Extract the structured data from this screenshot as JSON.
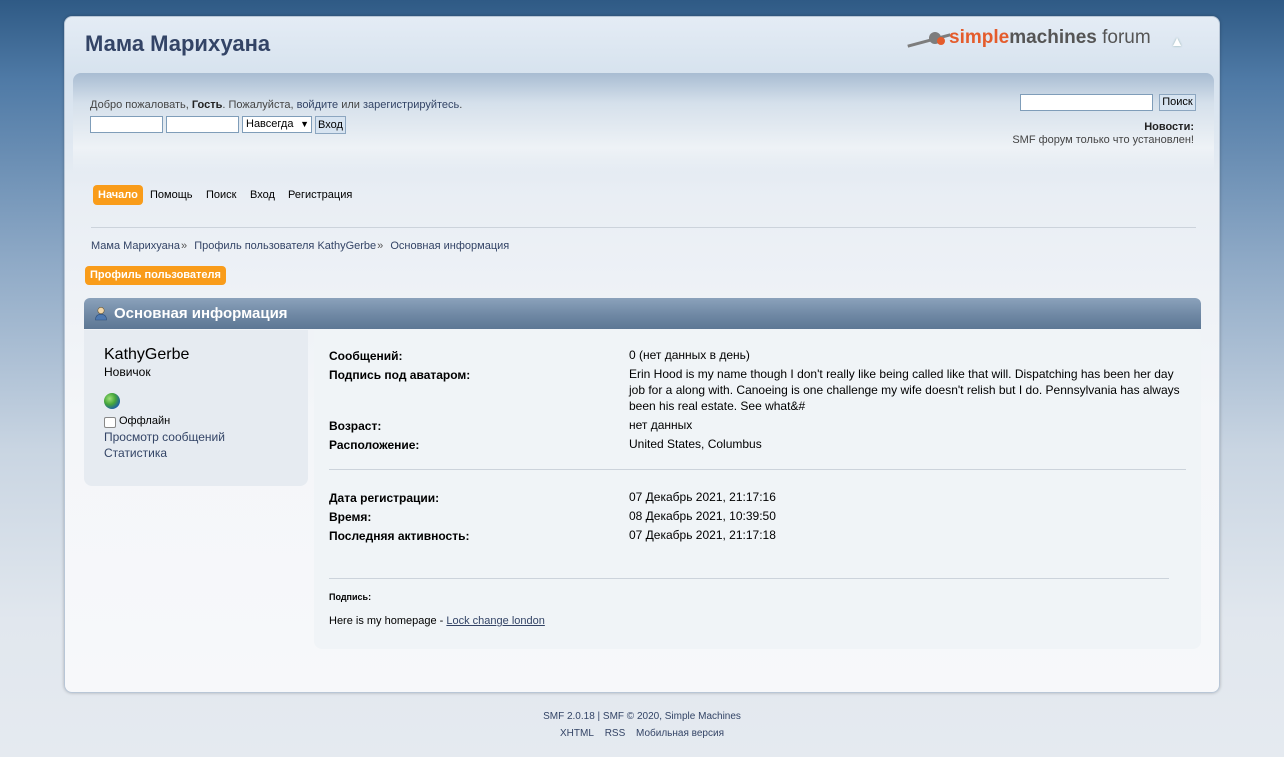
{
  "forum": {
    "title": "Мама Марихуана"
  },
  "logo": {
    "simple": "simple",
    "machines": "machines",
    "forum": " forum"
  },
  "welcome": {
    "prefix": "Добро пожаловать, ",
    "guest": "Гость",
    "middle": ". Пожалуйста, ",
    "login_link": "войдите",
    "or": " или ",
    "register_link": "зарегистрируйтесь",
    "suffix": "."
  },
  "login": {
    "duration": "Навсегда",
    "button": "Вход"
  },
  "search": {
    "button": "Поиск"
  },
  "news": {
    "title": "Новости:",
    "text": "SMF форум только что установлен!"
  },
  "menu": [
    {
      "label": "Начало",
      "active": true
    },
    {
      "label": "Помощь"
    },
    {
      "label": "Поиск"
    },
    {
      "label": "Вход"
    },
    {
      "label": "Регистрация"
    }
  ],
  "breadcrumb": [
    "Мама Марихуана",
    "Профиль пользователя KathyGerbe",
    "Основная информация"
  ],
  "breadcrumb_sep": "»",
  "profile_tab": "Профиль пользователя",
  "section_title": "Основная информация",
  "user": {
    "name": "KathyGerbe",
    "rank": "Новичок",
    "status": "Оффлайн",
    "view_posts": "Просмотр сообщений",
    "statistics": "Статистика"
  },
  "details": {
    "posts_label": "Сообщений:",
    "posts_value": "0 (нет данных в день)",
    "signature_label": "Подпись под аватаром:",
    "signature_value": "Erin Hood is my name though I don't really like being called like that will. Dispatching has been her day job for a along with. Canoeing is one challenge my wife doesn't relish but I do. Pennsylvania has always been his real estate. See what&#",
    "age_label": "Возраст:",
    "age_value": "нет данных",
    "location_label": "Расположение:",
    "location_value": "United States, Columbus",
    "registered_label": "Дата регистрации:",
    "registered_value": "07 Декабрь 2021, 21:17:16",
    "time_label": "Время:",
    "time_value": "08 Декабрь 2021, 10:39:50",
    "last_active_label": "Последняя активность:",
    "last_active_value": "07 Декабрь 2021, 21:17:18"
  },
  "signature": {
    "label": "Подпись:",
    "text": "Here is my homepage - ",
    "link": "Lock change london"
  },
  "footer": {
    "line1_a": "SMF 2.0.18",
    "line1_sep": " | ",
    "line1_b": "SMF © 2020",
    "line1_c": ", ",
    "line1_d": "Simple Machines",
    "links": [
      "XHTML",
      "RSS",
      "Мобильная версия"
    ]
  },
  "colors": {
    "accent": "#f99c1a",
    "link": "#334466",
    "cat_bar": "#6f88a4"
  }
}
